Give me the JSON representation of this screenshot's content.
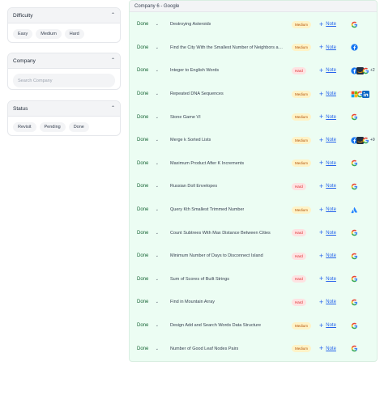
{
  "filters": {
    "difficulty": {
      "title": "Difficulty",
      "options": [
        "Easy",
        "Medium",
        "Hard"
      ]
    },
    "company": {
      "title": "Company",
      "search_placeholder": "Search Company"
    },
    "status": {
      "title": "Status",
      "options": [
        "Revisit",
        "Pending",
        "Done"
      ]
    }
  },
  "panel": {
    "title": "Company 6 - Google",
    "note_label": "Note",
    "rows": [
      {
        "status": "Done",
        "problem": "Destroying Asteroids",
        "difficulty": "Medium",
        "logos": [
          "google-logo"
        ],
        "more": ""
      },
      {
        "status": "Done",
        "problem": "Find the City With the Smallest Number of Neighbors at a Threshold Distance",
        "difficulty": "Medium",
        "logos": [
          "facebook-logo"
        ],
        "more": ""
      },
      {
        "status": "Done",
        "problem": "Integer to English Words",
        "difficulty": "Hard",
        "logos": [
          "facebook-logo",
          "amazon-logo",
          "google-logo"
        ],
        "more": "+2"
      },
      {
        "status": "Done",
        "problem": "Repeated DNA Sequences",
        "difficulty": "Medium",
        "logos": [
          "microsoft-logo",
          "google-logo",
          "linkedin-logo"
        ],
        "more": ""
      },
      {
        "status": "Done",
        "problem": "Stone Game VI",
        "difficulty": "Medium",
        "logos": [
          "google-logo"
        ],
        "more": ""
      },
      {
        "status": "Done",
        "problem": "Merge k Sorted Lists",
        "difficulty": "Medium",
        "logos": [
          "facebook-logo",
          "amazon-logo",
          "google-logo"
        ],
        "more": "+9"
      },
      {
        "status": "Done",
        "problem": "Maximum Product After K Increments",
        "difficulty": "Medium",
        "logos": [
          "google-logo"
        ],
        "more": ""
      },
      {
        "status": "Done",
        "problem": "Russian Doll Envelopes",
        "difficulty": "Hard",
        "logos": [
          "google-logo"
        ],
        "more": ""
      },
      {
        "status": "Done",
        "problem": "Query Kth Smallest Trimmed Number",
        "difficulty": "Medium",
        "logos": [
          "atlassian-logo"
        ],
        "more": ""
      },
      {
        "status": "Done",
        "problem": "Count Subtrees With Max Distance Between Cities",
        "difficulty": "Hard",
        "logos": [
          "google-logo"
        ],
        "more": ""
      },
      {
        "status": "Done",
        "problem": "Minimum Number of Days to Disconnect Island",
        "difficulty": "Hard",
        "logos": [
          "google-logo"
        ],
        "more": ""
      },
      {
        "status": "Done",
        "problem": "Sum of Scores of Built Strings",
        "difficulty": "Hard",
        "logos": [
          "google-logo"
        ],
        "more": ""
      },
      {
        "status": "Done",
        "problem": "Find in Mountain Array",
        "difficulty": "Hard",
        "logos": [
          "google-logo"
        ],
        "more": ""
      },
      {
        "status": "Done",
        "problem": "Design Add and Search Words Data Structure",
        "difficulty": "Medium",
        "logos": [
          "google-logo"
        ],
        "more": ""
      },
      {
        "status": "Done",
        "problem": "Number of Good Leaf Nodes Pairs",
        "difficulty": "Medium",
        "logos": [
          "google-logo"
        ],
        "more": ""
      }
    ]
  },
  "colors": {
    "panel_bg": "#ecfdf3",
    "medium_bg": "#fef3c7",
    "medium_text": "#b45309",
    "hard_bg": "#fee2e2",
    "hard_text": "#dc2626",
    "note_link": "#2563eb",
    "done_text": "#166534"
  }
}
